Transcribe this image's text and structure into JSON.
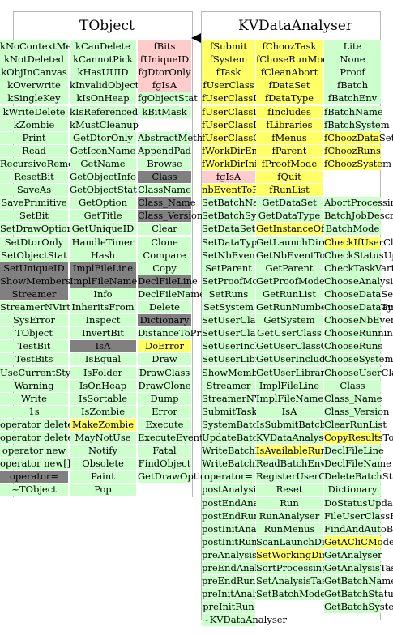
{
  "diagram": {
    "classes": [
      {
        "name": "TObject"
      },
      {
        "name": "KVDataAnalyser"
      }
    ],
    "tobject_columns": [
      [
        "kNoContextMenu",
        "kNotDeleted",
        "kObjInCanvas",
        "kOverwrite",
        "kSingleKey",
        "kWriteDelete",
        "kZombie",
        "Print",
        "Read",
        "RecursiveRemove",
        "ResetBit",
        "SaveAs",
        "SavePrimitive",
        "SetBit",
        "SetDrawOption",
        "SetDtorOnly",
        "SetObjectStat",
        "SetUniqueID",
        "ShowMembers",
        "Streamer",
        "StreamerNVirtual",
        "SysError",
        "TObject",
        "TestBit",
        "TestBits",
        "UseCurrentStyle",
        "Warning",
        "Write",
        "1s",
        "operator delete",
        "operator delete[]",
        "operator new",
        "operator new[]",
        "operator=",
        "~TObject"
      ],
      [
        "kCanDelete",
        "kCannotPick",
        "kHasUUID",
        "kInvalidObject",
        "kIsOnHeap",
        "kIsReferenced",
        "kMustCleanup",
        "GetDtorOnly",
        "GetIconName",
        "GetName",
        "GetObjectInfo",
        "GetObjectStat",
        "GetOption",
        "GetTitle",
        "GetUniqueID",
        "HandleTimer",
        "Hash",
        "ImplFileLine",
        "ImplFileName",
        "Info",
        "InheritsFrom",
        "Inspect",
        "InvertBit",
        "IsA",
        "IsEqual",
        "IsFolder",
        "IsOnHeap",
        "IsSortable",
        "IsZombie",
        "MakeZombie",
        "MayNotUse",
        "Notify",
        "Obsolete",
        "Paint",
        "Pop"
      ],
      [
        "fBits",
        "fUniqueID",
        "fgDtorOnly",
        "fgIsA",
        "fgObjectStat",
        "kBitMask",
        "",
        "AbstractMethod",
        "AppendPad",
        "Browse",
        "Class",
        "ClassName",
        "Class_Name",
        "Class_Version",
        "Clear",
        "Clone",
        "Compare",
        "Copy",
        "DeclFileLine",
        "DeclFileName",
        "Delete",
        "Dictionary",
        "DistanceToPrimitive",
        "DoError",
        "Draw",
        "DrawClass",
        "DrawClone",
        "Dump",
        "Error",
        "Execute",
        "ExecuteEvent",
        "Fatal",
        "FindObject",
        "GetDrawOption"
      ]
    ],
    "kv_columns": [
      [
        "fSubmit",
        "fSystem",
        "fTask",
        "fUserClass",
        "fUserClassDec",
        "fUserClassImp",
        "fUserClassIsOK",
        "fUserClassOptions",
        "fWorkDirEnd",
        "fWorkDirInit",
        "fgIsA",
        "nbEventToRead",
        "SetBatchName",
        "SetBatchSystem",
        "SetDataSet",
        "SetDataType",
        "SetNbEventToRead",
        "SetParent",
        "SetProofMode",
        "SetRuns",
        "SetSystem",
        "SetUserClass",
        "SetUserClassOptions",
        "SetUserIncludes",
        "SetUserLibraries",
        "ShowMembers",
        "Streamer",
        "StreamerNVirtual",
        "SubmitTask",
        "SystemBatchName",
        "UpdateBatchStatusFile",
        "WriteBatchEnvFile",
        "WriteBatchInfo",
        "operator=",
        "postAnalysis",
        "postEndAnalysis",
        "postEndRun",
        "postInitAnalysis",
        "postInitRun",
        "preAnalysis",
        "preEndAnalysis",
        "preEndRun",
        "preInitAnalysis",
        "preInitRun",
        "~KVDataAnalyser"
      ],
      [
        "fChoozTask",
        "fChoseRunMode",
        "fCleanAbort",
        "fDataSet",
        "fDataType",
        "fIncludes",
        "fLibraries",
        "fMenus",
        "fParent",
        "fProofMode",
        "fQuit",
        "fRunList",
        "GetDataSet",
        "GetDataType",
        "GetInstanceOfUserClass",
        "GetLaunchDirectory",
        "GetNbEventToRead",
        "GetParent",
        "GetProofMode",
        "GetRunList",
        "GetRunNumberFromFileName",
        "GetSystem",
        "GetUserClass",
        "GetUserClassOptions",
        "GetUserIncludes",
        "GetUserLibraries",
        "ImplFileLine",
        "ImplFileName",
        "IsA",
        "IsSubmitBatchValid",
        "KVDataAnalyser",
        "IsAvailableRuns",
        "ReadBatchEnvFile",
        "RegisterUserClass",
        "Reset",
        "Run",
        "RunAnalyser",
        "RunMenus",
        "ScanLaunchDirectory",
        "SetWorkingDirectory",
        "SortProcessingList",
        "SetAnalysisTask",
        "SetBatchMode"
      ],
      [
        "Lite",
        "None",
        "Proof",
        "fBatch",
        "fBatchEnv",
        "fBatchName",
        "fBatchSystem",
        "fChoozDataSet",
        "fChoozRuns",
        "fChoozSystem",
        "",
        "",
        "AbortProcessingLoop",
        "BatchJobDescription",
        "BatchMode",
        "CheckIfUserClassIsValid",
        "CheckStatusUpdateInterval",
        "CheckTaskVariables",
        "ChooseAnalysisTask",
        "ChooseDataSet",
        "ChooseDataType",
        "ChooseNbEventToRead",
        "ChooseRunningMode",
        "ChooseRuns",
        "ChooseSystem",
        "ChooseUserClass",
        "Class",
        "Class_Name",
        "Class_Version",
        "ClearRunList",
        "CopyResultsToLaunchDirectory",
        "DeclFileLine",
        "DeclFileName",
        "DeleteBatchStatusFile",
        "Dictionary",
        "DoStatusUpdate",
        "FileUserClassFilesExist",
        "FindAndAutoBatchName",
        "GetACliCMode",
        "GetAnalyser",
        "GetAnalysisTask",
        "GetBatchName",
        "GetBatchStatusFileName",
        "GetBatchSystem"
      ]
    ],
    "legend_colors": {
      "public": "#ccffcc",
      "protected": "#ffff66",
      "private": "#ffcccc",
      "inherited": "#808080"
    },
    "arrow_icon": "inheritance-arrow-icon"
  }
}
